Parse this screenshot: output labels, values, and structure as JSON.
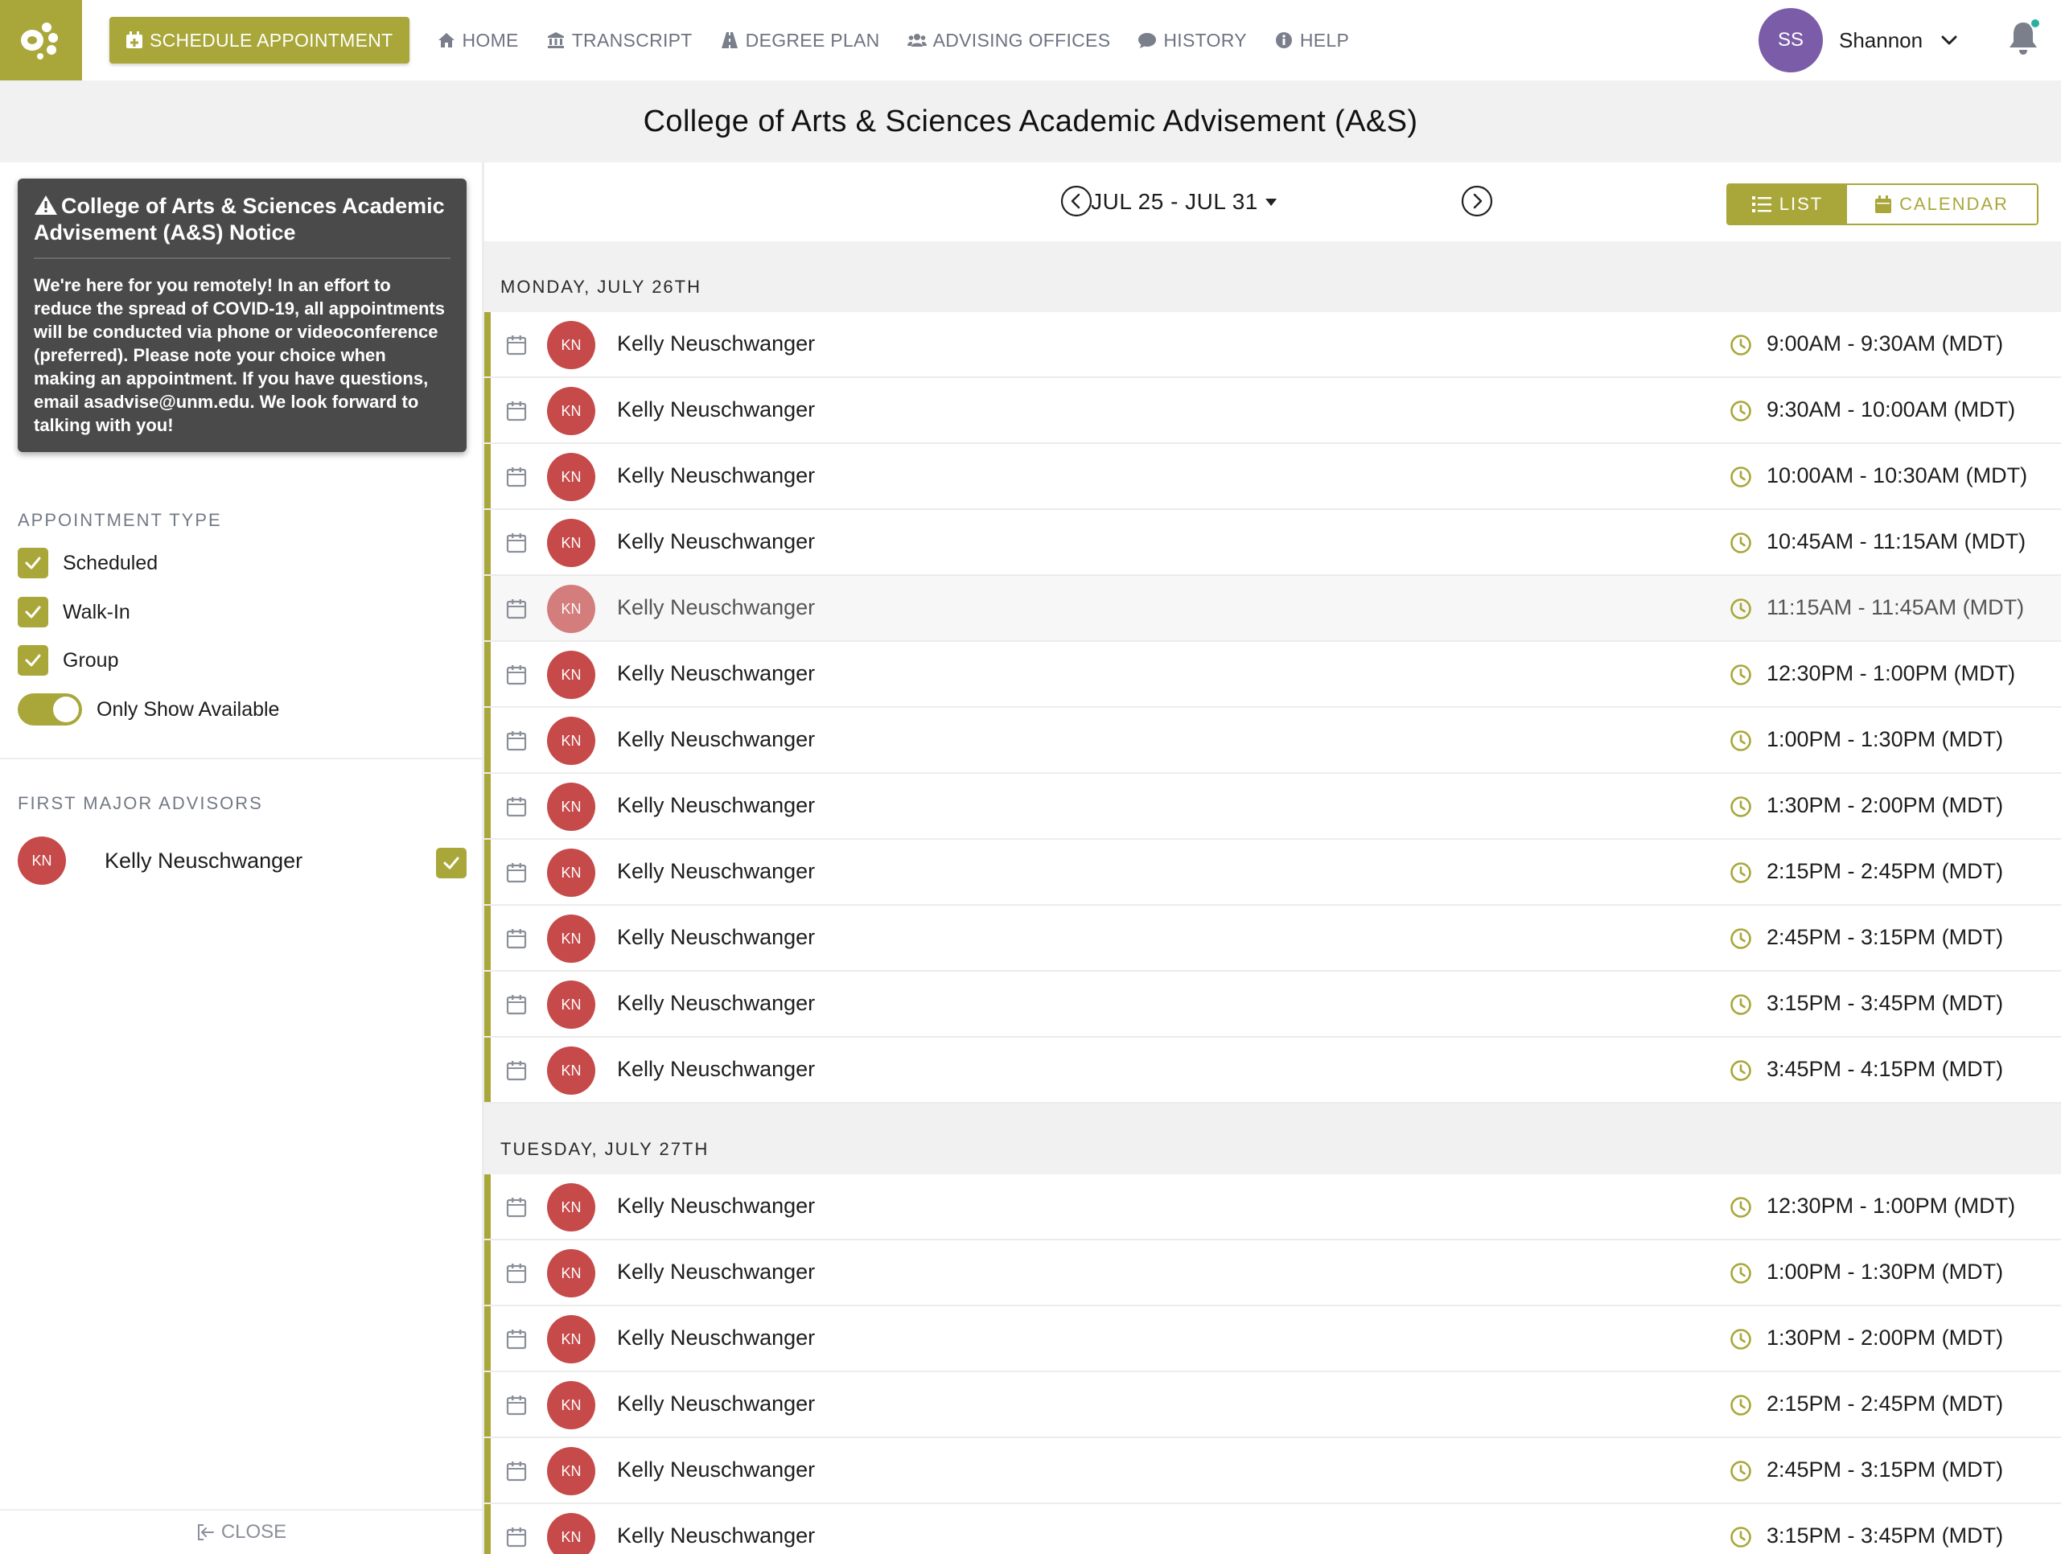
{
  "nav": {
    "schedule_label": "SCHEDULE APPOINTMENT",
    "items": [
      {
        "label": "HOME",
        "icon": "home-icon"
      },
      {
        "label": "TRANSCRIPT",
        "icon": "bank-icon"
      },
      {
        "label": "DEGREE PLAN",
        "icon": "road-icon"
      },
      {
        "label": "ADVISING OFFICES",
        "icon": "users-icon"
      },
      {
        "label": "HISTORY",
        "icon": "comment-icon"
      },
      {
        "label": "HELP",
        "icon": "info-icon"
      }
    ],
    "user_initials": "SS",
    "user_name": "Shannon"
  },
  "page_title": "College of Arts & Sciences Academic Advisement (A&S)",
  "notice": {
    "title": "College of Arts & Sciences Academic Advisement (A&S) Notice",
    "body": "We're here for you remotely! In an effort to reduce the spread of COVID-19, all appointments will be conducted via phone or videoconference (preferred). Please note your choice when making an appointment. If you have questions, email asadvise@unm.edu. We look forward to talking with you!"
  },
  "filters": {
    "heading": "APPOINTMENT TYPE",
    "types": [
      "Scheduled",
      "Walk-In",
      "Group"
    ],
    "toggle_label": "Only Show Available"
  },
  "advisors": {
    "heading": "FIRST MAJOR ADVISORS",
    "list": [
      {
        "initials": "KN",
        "name": "Kelly Neuschwanger"
      }
    ]
  },
  "close_label": "CLOSE",
  "week": {
    "label": "JUL 25 - JUL 31",
    "list_label": "LIST",
    "calendar_label": "CALENDAR"
  },
  "days": [
    {
      "label": "MONDAY, JULY 26TH",
      "slots": [
        {
          "initials": "KN",
          "name": "Kelly Neuschwanger",
          "time": "9:00AM - 9:30AM (MDT)"
        },
        {
          "initials": "KN",
          "name": "Kelly Neuschwanger",
          "time": "9:30AM - 10:00AM (MDT)"
        },
        {
          "initials": "KN",
          "name": "Kelly Neuschwanger",
          "time": "10:00AM - 10:30AM (MDT)"
        },
        {
          "initials": "KN",
          "name": "Kelly Neuschwanger",
          "time": "10:45AM - 11:15AM (MDT)"
        },
        {
          "initials": "KN",
          "name": "Kelly Neuschwanger",
          "time": "11:15AM - 11:45AM (MDT)"
        },
        {
          "initials": "KN",
          "name": "Kelly Neuschwanger",
          "time": "12:30PM - 1:00PM (MDT)"
        },
        {
          "initials": "KN",
          "name": "Kelly Neuschwanger",
          "time": "1:00PM - 1:30PM (MDT)"
        },
        {
          "initials": "KN",
          "name": "Kelly Neuschwanger",
          "time": "1:30PM - 2:00PM (MDT)"
        },
        {
          "initials": "KN",
          "name": "Kelly Neuschwanger",
          "time": "2:15PM - 2:45PM (MDT)"
        },
        {
          "initials": "KN",
          "name": "Kelly Neuschwanger",
          "time": "2:45PM - 3:15PM (MDT)"
        },
        {
          "initials": "KN",
          "name": "Kelly Neuschwanger",
          "time": "3:15PM - 3:45PM (MDT)"
        },
        {
          "initials": "KN",
          "name": "Kelly Neuschwanger",
          "time": "3:45PM - 4:15PM (MDT)"
        }
      ]
    },
    {
      "label": "TUESDAY, JULY 27TH",
      "slots": [
        {
          "initials": "KN",
          "name": "Kelly Neuschwanger",
          "time": "12:30PM - 1:00PM (MDT)"
        },
        {
          "initials": "KN",
          "name": "Kelly Neuschwanger",
          "time": "1:00PM - 1:30PM (MDT)"
        },
        {
          "initials": "KN",
          "name": "Kelly Neuschwanger",
          "time": "1:30PM - 2:00PM (MDT)"
        },
        {
          "initials": "KN",
          "name": "Kelly Neuschwanger",
          "time": "2:15PM - 2:45PM (MDT)"
        },
        {
          "initials": "KN",
          "name": "Kelly Neuschwanger",
          "time": "2:45PM - 3:15PM (MDT)"
        },
        {
          "initials": "KN",
          "name": "Kelly Neuschwanger",
          "time": "3:15PM - 3:45PM (MDT)"
        }
      ]
    }
  ],
  "colors": {
    "accent": "#a9a73a",
    "avatar_red": "#c64a4a",
    "user_avatar": "#7b5ca8",
    "notice_bg": "#4a4a4a"
  }
}
